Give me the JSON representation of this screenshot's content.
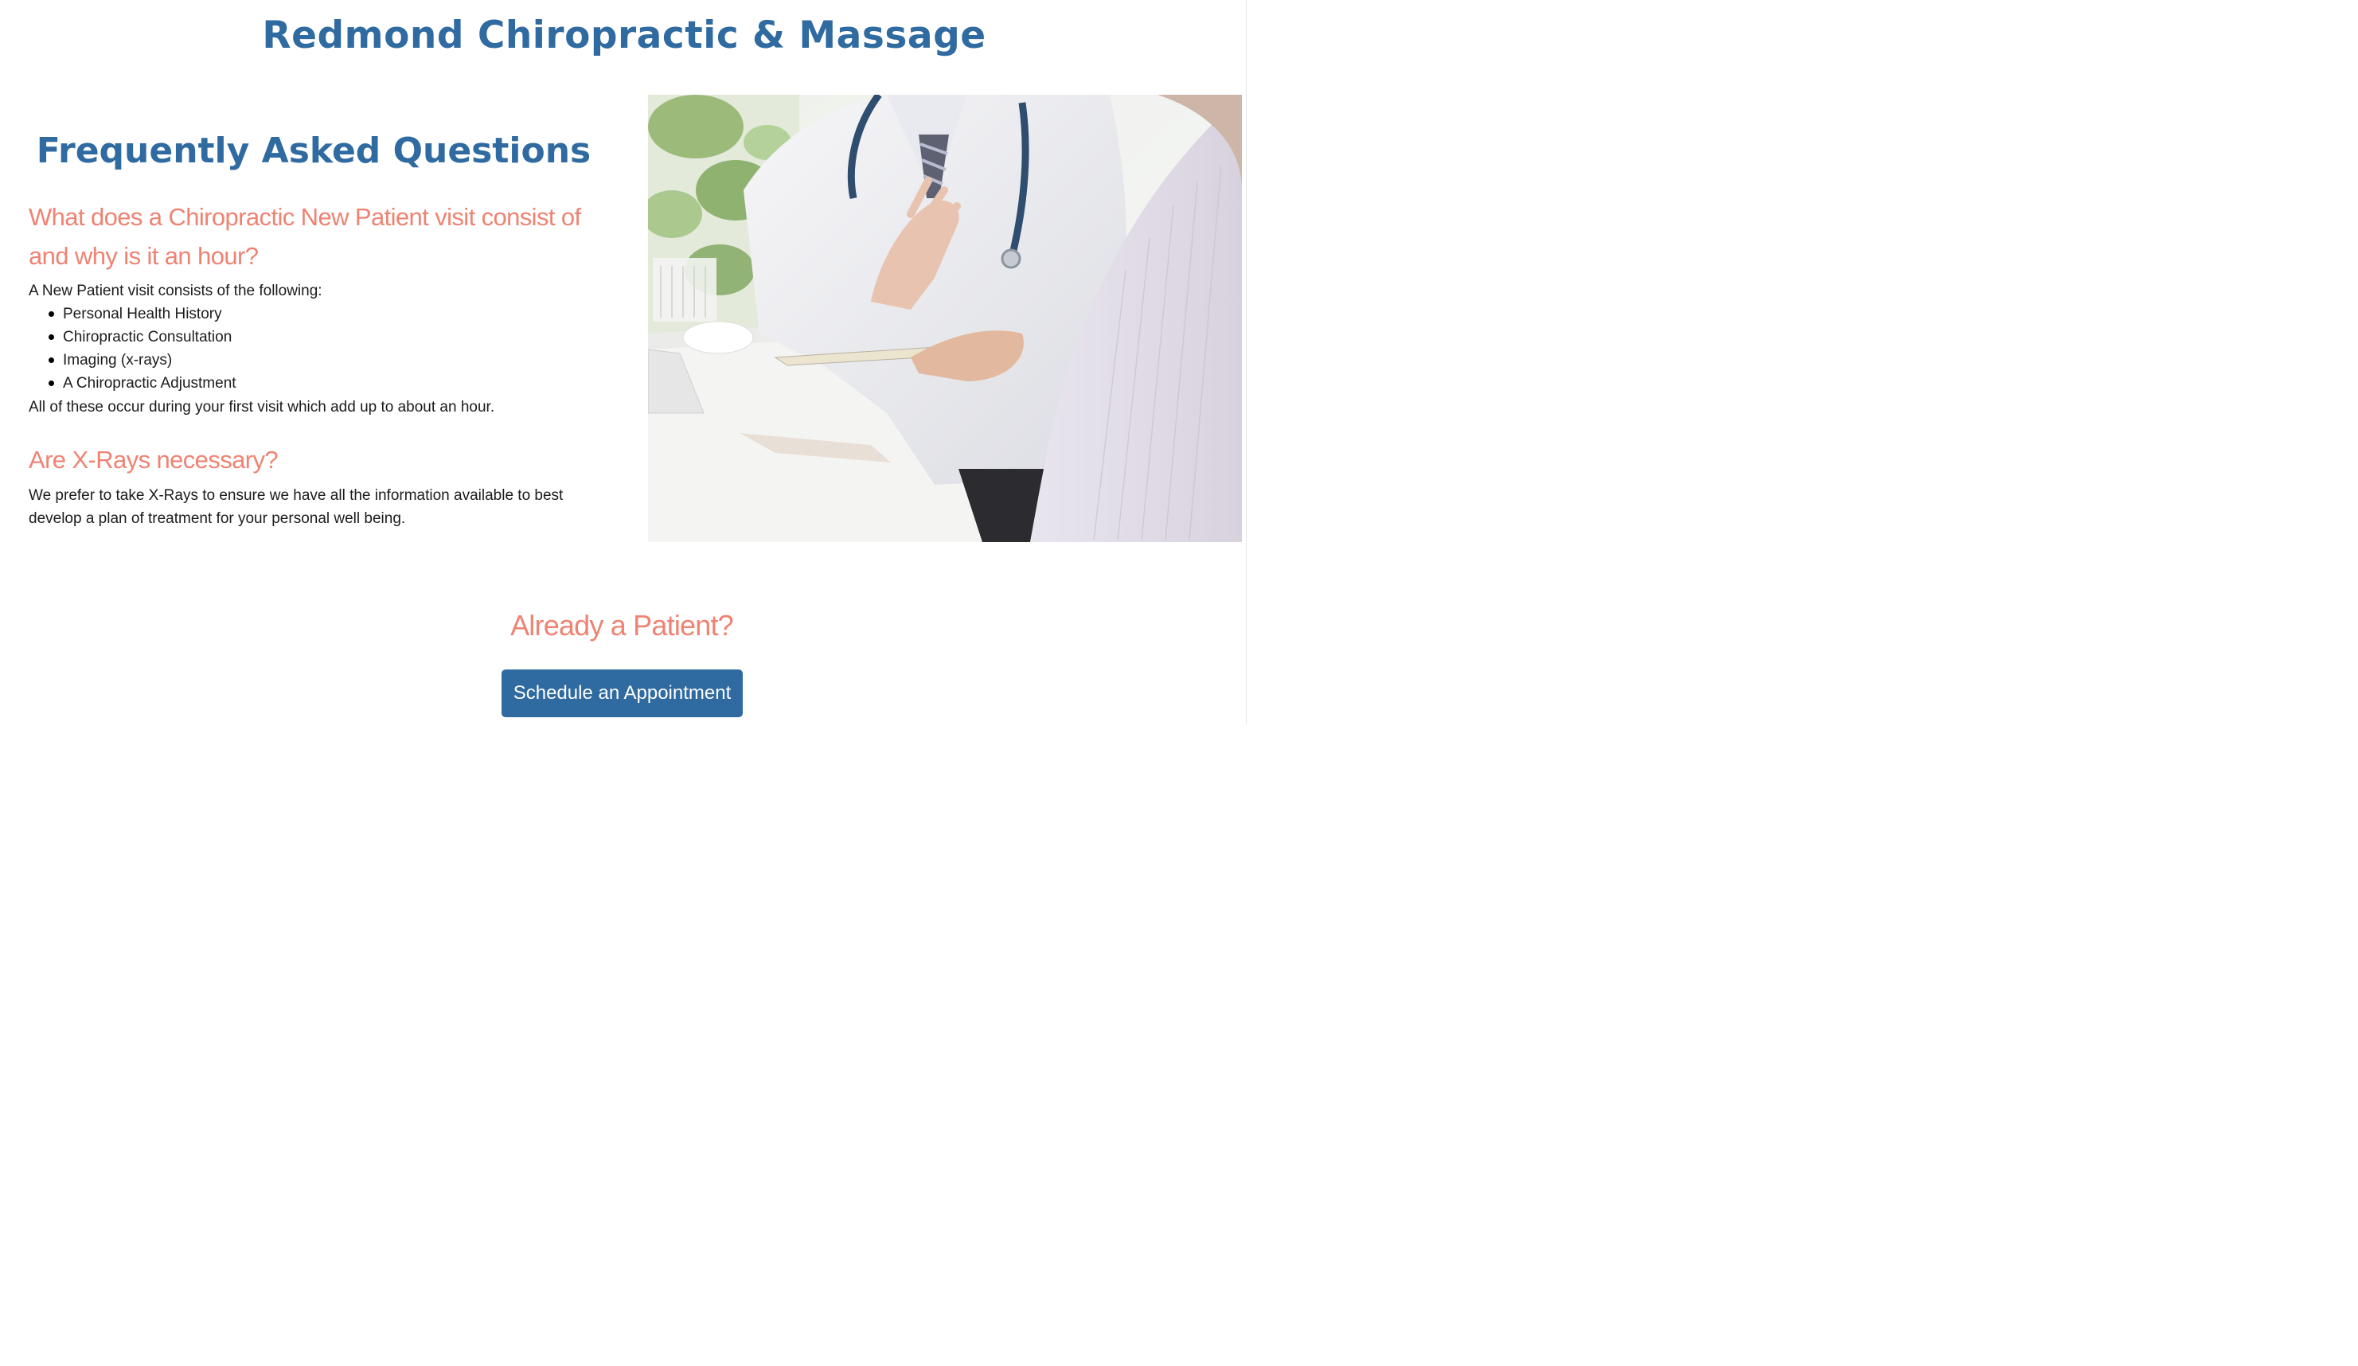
{
  "header": {
    "site_title": "Redmond Chiropractic & Massage"
  },
  "faq": {
    "heading": "Frequently Asked Questions",
    "items": [
      {
        "question": "What does a Chiropractic New Patient visit consist of and why is it an hour?",
        "intro": "A New Patient visit consists of the following:",
        "list": [
          "Personal Health History",
          "Chiropractic Consultation",
          "Imaging (x-rays)",
          "A Chiropractic Adjustment"
        ],
        "outro": "All of these occur during your first visit which add up to about an hour."
      },
      {
        "question": "Are X-Rays necessary?",
        "answer": "We prefer to take X-Rays to ensure we have all the information available to best develop a plan of treatment for your personal well being."
      }
    ]
  },
  "cta": {
    "heading": "Already a Patient?",
    "button_label": "Schedule an Appointment"
  },
  "colors": {
    "brand_blue": "#2f6aa0",
    "accent_salmon": "#ef8373",
    "text": "#1b1b1b"
  }
}
